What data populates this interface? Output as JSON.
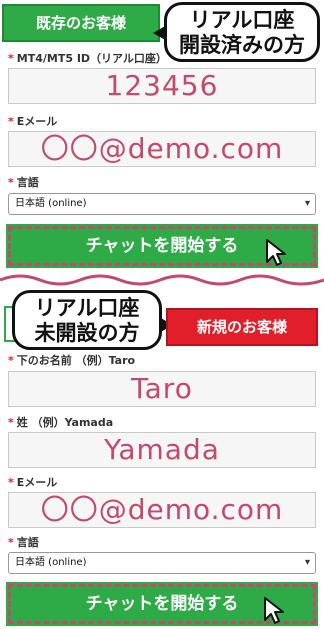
{
  "existing": {
    "tab_label": "既存のお客様",
    "bubble_line1": "リアル口座",
    "bubble_line2": "開設済みの方",
    "id_label": "MT4/MT5 ID（リアル口座）",
    "id_value": "123456",
    "email_label": "Eメール",
    "email_value": "〇〇@demo.com",
    "language_label": "言語",
    "language_value": "日本語 (online)",
    "chat_button": "チャットを開始する"
  },
  "new": {
    "tab_label": "新規のお客様",
    "bubble_line1": "リアル口座",
    "bubble_line2": "未開設の方",
    "firstname_label": "下のお名前 （例）Taro",
    "firstname_value": "Taro",
    "lastname_label": "姓 （例）Yamada",
    "lastname_value": "Yamada",
    "email_label": "Eメール",
    "email_value": "〇〇@demo.com",
    "language_label": "言語",
    "language_value": "日本語 (online)",
    "chat_button": "チャットを開始する"
  },
  "required_mark": "*",
  "colors": {
    "green": "#2eaa46",
    "red": "#e01f2a",
    "pink_text": "#c24a6e"
  },
  "icons": {
    "cursor": "mouse-pointer-icon",
    "select_arrow": "chevron-down-icon"
  }
}
